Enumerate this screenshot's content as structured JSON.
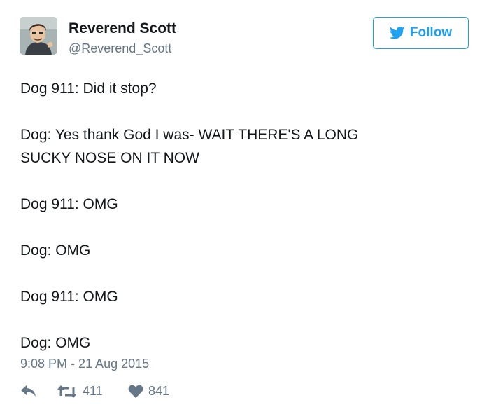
{
  "user": {
    "name": "Reverend Scott",
    "handle": "@Reverend_Scott"
  },
  "follow_button": {
    "label": "Follow",
    "icon": "twitter-bird-icon"
  },
  "tweet": {
    "lines": [
      "Dog 911: Did it stop?",
      "",
      "Dog: Yes thank God I was- WAIT THERE'S A LONG",
      "SUCKY NOSE ON IT NOW",
      "",
      "Dog 911: OMG",
      "",
      "Dog: OMG",
      "",
      "Dog 911: OMG",
      "",
      "Dog: OMG"
    ],
    "timestamp": "9:08 PM - 21 Aug 2015"
  },
  "actions": {
    "reply_icon": "reply-icon",
    "retweet_icon": "retweet-icon",
    "retweet_count": "411",
    "like_icon": "heart-icon",
    "like_count": "841"
  },
  "colors": {
    "accent": "#1da1f2",
    "text": "#14171a",
    "muted": "#657786"
  }
}
